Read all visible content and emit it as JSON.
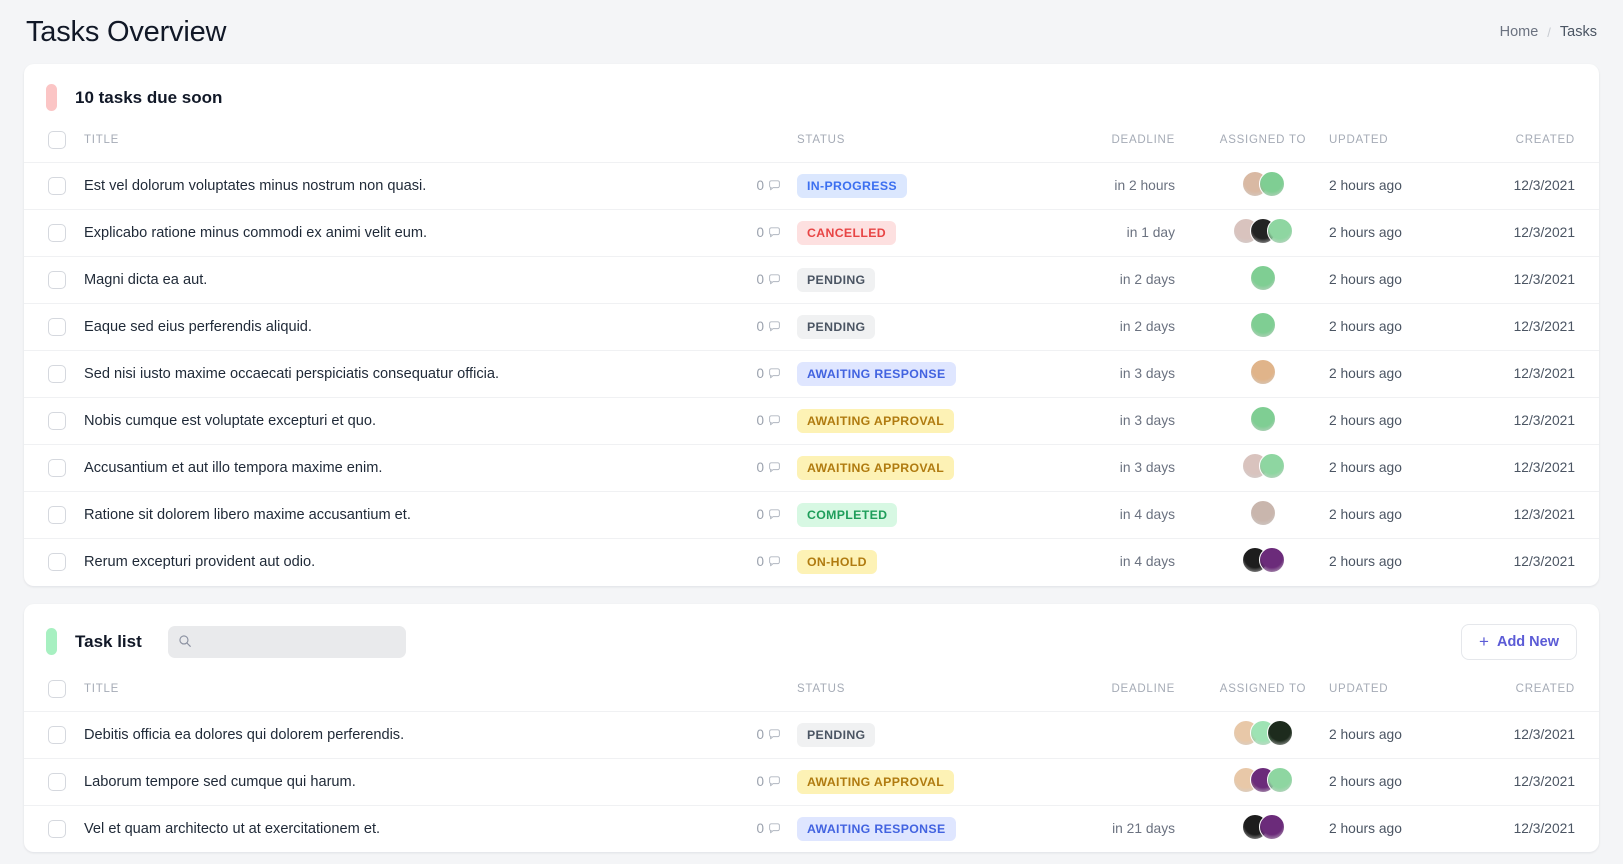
{
  "header": {
    "title": "Tasks Overview",
    "breadcrumb": {
      "home": "Home",
      "separator": "/",
      "current": "Tasks"
    }
  },
  "colors": {
    "page_bg": "#f4f5f7",
    "card_bg": "#ffffff",
    "accent_due_soon": "#fbc5c5",
    "accent_task_list": "#a7f0c1",
    "add_new_text": "#5b5bd6",
    "status_in_progress_bg": "#dbe7fe",
    "status_in_progress_fg": "#3b6ff0",
    "status_cancelled_bg": "#fde0e0",
    "status_cancelled_fg": "#e84545",
    "status_pending_bg": "#f0f1f2",
    "status_pending_fg": "#4b5563",
    "status_awaiting_response_bg": "#dfe6ff",
    "status_awaiting_response_fg": "#4263e0",
    "status_awaiting_approval_bg": "#fdf2b5",
    "status_awaiting_approval_fg": "#b07b10",
    "status_completed_bg": "#d7f8e3",
    "status_completed_fg": "#1e9e5a",
    "status_on_hold_bg": "#fdf2b5",
    "status_on_hold_fg": "#b07b10"
  },
  "table_columns": [
    "TITLE",
    "STATUS",
    "DEADLINE",
    "ASSIGNED TO",
    "UPDATED",
    "CREATED"
  ],
  "search": {
    "value": "",
    "placeholder": ""
  },
  "buttons": {
    "add_new": "Add New",
    "add_new_icon": "plus-icon"
  },
  "cards": [
    {
      "id": "due-soon",
      "title": "10 tasks due soon",
      "accent": "#fbc5c5",
      "has_search": false,
      "has_add_new": false,
      "columns": {
        "title": "TITLE",
        "status": "STATUS",
        "deadline": "DEADLINE",
        "assigned": "ASSIGNED TO",
        "updated": "UPDATED",
        "created": "CREATED"
      },
      "rows": [
        {
          "title": "Est vel dolorum voluptates minus nostrum non quasi.",
          "comments": "0",
          "status": "IN-PROGRESS",
          "status_key": "in_progress",
          "deadline": "in 2 hours",
          "avatars": [
            "#d9b9a3",
            "#7fce93"
          ],
          "updated": "2 hours ago",
          "created": "12/3/2021"
        },
        {
          "title": "Explicabo ratione minus commodi ex animi velit eum.",
          "comments": "0",
          "status": "CANCELLED",
          "status_key": "cancelled",
          "deadline": "in 1 day",
          "avatars": [
            "#d9c3be",
            "#232323",
            "#8ed6a1"
          ],
          "updated": "2 hours ago",
          "created": "12/3/2021"
        },
        {
          "title": "Magni dicta ea aut.",
          "comments": "0",
          "status": "PENDING",
          "status_key": "pending",
          "deadline": "in 2 days",
          "avatars": [
            "#7fce93"
          ],
          "updated": "2 hours ago",
          "created": "12/3/2021"
        },
        {
          "title": "Eaque sed eius perferendis aliquid.",
          "comments": "0",
          "status": "PENDING",
          "status_key": "pending",
          "deadline": "in 2 days",
          "avatars": [
            "#7fce93"
          ],
          "updated": "2 hours ago",
          "created": "12/3/2021"
        },
        {
          "title": "Sed nisi iusto maxime occaecati perspiciatis consequatur officia.",
          "comments": "0",
          "status": "AWAITING RESPONSE",
          "status_key": "awaiting_response",
          "deadline": "in 3 days",
          "avatars": [
            "#e0b48a"
          ],
          "updated": "2 hours ago",
          "created": "12/3/2021"
        },
        {
          "title": "Nobis cumque est voluptate excepturi et quo.",
          "comments": "0",
          "status": "AWAITING APPROVAL",
          "status_key": "awaiting_approval",
          "deadline": "in 3 days",
          "avatars": [
            "#7fce93"
          ],
          "updated": "2 hours ago",
          "created": "12/3/2021"
        },
        {
          "title": "Accusantium et aut illo tempora maxime enim.",
          "comments": "0",
          "status": "AWAITING APPROVAL",
          "status_key": "awaiting_approval",
          "deadline": "in 3 days",
          "avatars": [
            "#d9c3be",
            "#8ed6a1"
          ],
          "updated": "2 hours ago",
          "created": "12/3/2021"
        },
        {
          "title": "Ratione sit dolorem libero maxime accusantium et.",
          "comments": "0",
          "status": "COMPLETED",
          "status_key": "completed",
          "deadline": "in 4 days",
          "avatars": [
            "#c9b6ad"
          ],
          "updated": "2 hours ago",
          "created": "12/3/2021"
        },
        {
          "title": "Rerum excepturi provident aut odio.",
          "comments": "0",
          "status": "ON-HOLD",
          "status_key": "on_hold",
          "deadline": "in 4 days",
          "avatars": [
            "#1d1d1d",
            "#6b2b7a"
          ],
          "updated": "2 hours ago",
          "created": "12/3/2021"
        }
      ]
    },
    {
      "id": "task-list",
      "title": "Task list",
      "accent": "#a7f0c1",
      "has_search": true,
      "has_add_new": true,
      "columns": {
        "title": "TITLE",
        "status": "STATUS",
        "deadline": "DEADLINE",
        "assigned": "ASSIGNED TO",
        "updated": "UPDATED",
        "created": "CREATED"
      },
      "rows": [
        {
          "title": "Debitis officia ea dolores qui dolorem perferendis.",
          "comments": "0",
          "status": "PENDING",
          "status_key": "pending",
          "deadline": "",
          "avatars": [
            "#e8c8a8",
            "#9ee3b4",
            "#1d2b1d"
          ],
          "updated": "2 hours ago",
          "created": "12/3/2021"
        },
        {
          "title": "Laborum tempore sed cumque qui harum.",
          "comments": "0",
          "status": "AWAITING APPROVAL",
          "status_key": "awaiting_approval",
          "deadline": "",
          "avatars": [
            "#e8c8a8",
            "#6b2b7a",
            "#8ed6a1"
          ],
          "updated": "2 hours ago",
          "created": "12/3/2021"
        },
        {
          "title": "Vel et quam architecto ut at exercitationem et.",
          "comments": "0",
          "status": "AWAITING RESPONSE",
          "status_key": "awaiting_response",
          "deadline": "in 21 days",
          "avatars": [
            "#1d1d1d",
            "#6b2b7a"
          ],
          "updated": "2 hours ago",
          "created": "12/3/2021"
        }
      ]
    }
  ]
}
